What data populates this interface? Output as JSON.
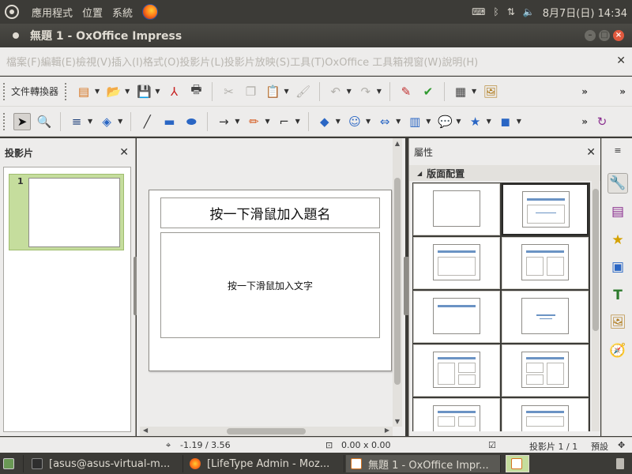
{
  "system_panel": {
    "menus": [
      "應用程式",
      "位置",
      "系統"
    ],
    "tray": {
      "keyboard_icon": "keyboard-icon",
      "bluetooth_icon": "bluetooth-icon",
      "network_icon": "network-icon",
      "volume_icon": "volume-icon",
      "datetime": "8月7日(日) 14:34"
    }
  },
  "window": {
    "title": "無題 1 - OxOffice Impress"
  },
  "menubar": {
    "items": [
      "檔案(F)",
      "編輯(E)",
      "檢視(V)",
      "插入(I)",
      "格式(O)",
      "投影片(L)",
      "投影片放映(S)",
      "工具(T)",
      "OxOffice 工具箱",
      "視窗(W)",
      "說明(H)"
    ]
  },
  "toolbar1": {
    "label": "文件轉換器"
  },
  "slides_pane": {
    "title": "投影片",
    "slides": [
      {
        "number": "1"
      }
    ]
  },
  "slide": {
    "title_placeholder": "按一下滑鼠加入題名",
    "body_placeholder": "按一下滑鼠加入文字"
  },
  "properties": {
    "title": "屬性",
    "section": "版面配置"
  },
  "statusbar": {
    "position": "-1.19 / 3.56",
    "size": "0.00 x 0.00",
    "slide_counter": "投影片 1 / 1",
    "master": "預設"
  },
  "taskbar": {
    "tasks": [
      {
        "label": "[asus@asus-virtual-m..."
      },
      {
        "label": "[LifeType Admin - Moz..."
      },
      {
        "label": "無題 1 - OxOffice Impr..."
      }
    ]
  },
  "colors": {
    "panel": "#3c3b37",
    "window_bg": "#edeceb",
    "accent_green": "#c5dd9d",
    "layout_bar": "#6b93c4"
  }
}
